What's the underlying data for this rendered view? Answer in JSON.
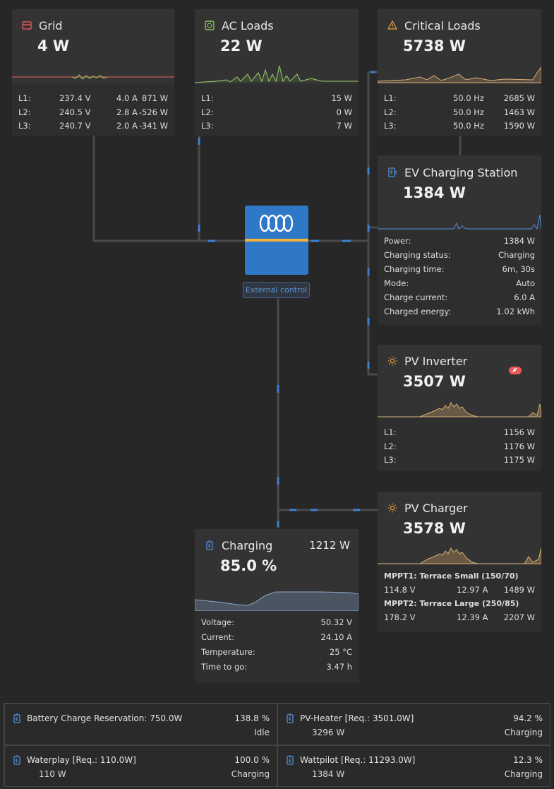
{
  "colors": {
    "background": "#272727",
    "card": "#333333",
    "wire": "#4a4a4a",
    "flow": "#3d82d6",
    "inverter": "#2f78c7",
    "stripe": "#f0b23a",
    "grid_icon": "#e05a5a",
    "ac_icon": "#8fbf5a",
    "warn_icon": "#e0a040",
    "sun_icon": "#e8a040",
    "battery_icon": "#4f8fdc"
  },
  "grid": {
    "title": "Grid",
    "icon": "grid-meter-icon",
    "power": "4 W",
    "rows": [
      {
        "label": "L1:",
        "v": "237.4 V",
        "a": "4.0 A",
        "w": "871 W"
      },
      {
        "label": "L2:",
        "v": "240.5 V",
        "a": "2.8 A",
        "w": "-526 W"
      },
      {
        "label": "L3:",
        "v": "240.7 V",
        "a": "2.0 A",
        "w": "-341 W"
      }
    ]
  },
  "ac_loads": {
    "title": "AC Loads",
    "icon": "ac-plug-icon",
    "power": "22 W",
    "rows": [
      {
        "label": "L1:",
        "w": "15 W"
      },
      {
        "label": "L2:",
        "w": "0 W"
      },
      {
        "label": "L3:",
        "w": "7 W"
      }
    ]
  },
  "critical_loads": {
    "title": "Critical Loads",
    "icon": "warning-icon",
    "power": "5738 W",
    "rows": [
      {
        "label": "L1:",
        "hz": "50.0 Hz",
        "w": "2685 W"
      },
      {
        "label": "L2:",
        "hz": "50.0 Hz",
        "w": "1463 W"
      },
      {
        "label": "L3:",
        "hz": "50.0 Hz",
        "w": "1590 W"
      }
    ]
  },
  "ev": {
    "title": "EV Charging Station",
    "icon": "ev-charger-icon",
    "power": "1384 W",
    "rows": [
      {
        "label": "Power:",
        "value": "1384 W"
      },
      {
        "label": "Charging status:",
        "value": "Charging"
      },
      {
        "label": "Charging time:",
        "value": "6m, 30s"
      },
      {
        "label": "Mode:",
        "value": "Auto"
      },
      {
        "label": "Charge current:",
        "value": "6.0 A"
      },
      {
        "label": "Charged energy:",
        "value": "1.02 kWh"
      }
    ]
  },
  "pv_inverter": {
    "title": "PV Inverter",
    "icon": "sun-icon",
    "power": "3507 W",
    "rows": [
      {
        "label": "L1:",
        "w": "1156 W"
      },
      {
        "label": "L2:",
        "w": "1176 W"
      },
      {
        "label": "L3:",
        "w": "1175 W"
      }
    ]
  },
  "pv_charger": {
    "title": "PV Charger",
    "icon": "sun-icon",
    "power": "3578 W",
    "mppt": [
      {
        "name": "MPPT1: Terrace Small (150/70)",
        "v": "114.8 V",
        "a": "12.97 A",
        "w": "1489 W"
      },
      {
        "name": "MPPT2: Terrace Large (250/85)",
        "v": "178.2 V",
        "a": "12.39 A",
        "w": "2207 W"
      }
    ]
  },
  "battery": {
    "title": "Charging",
    "icon": "battery-icon",
    "power": "1212 W",
    "soc": "85.0 %",
    "rows": [
      {
        "label": "Voltage:",
        "value": "50.32 V"
      },
      {
        "label": "Current:",
        "value": "24.10 A"
      },
      {
        "label": "Temperature:",
        "value": "25 °C"
      },
      {
        "label": "Time to go:",
        "value": "3.47 h"
      }
    ]
  },
  "inverter": {
    "control": "External control",
    "logo": "victron-logo"
  },
  "bottom": [
    {
      "name": "Battery Charge Reservation: 750.0W",
      "sub": "",
      "pct": "138.8 %",
      "status": "Idle"
    },
    {
      "name": "PV-Heater [Req.: 3501.0W]",
      "sub": "3296 W",
      "pct": "94.2 %",
      "status": "Charging"
    },
    {
      "name": "Waterplay [Req.: 110.0W]",
      "sub": "110 W",
      "pct": "100.0 %",
      "status": "Charging"
    },
    {
      "name": "Wattpilot [Req.: 11293.0W]",
      "sub": "1384 W",
      "pct": "12.3 %",
      "status": "Charging"
    }
  ]
}
